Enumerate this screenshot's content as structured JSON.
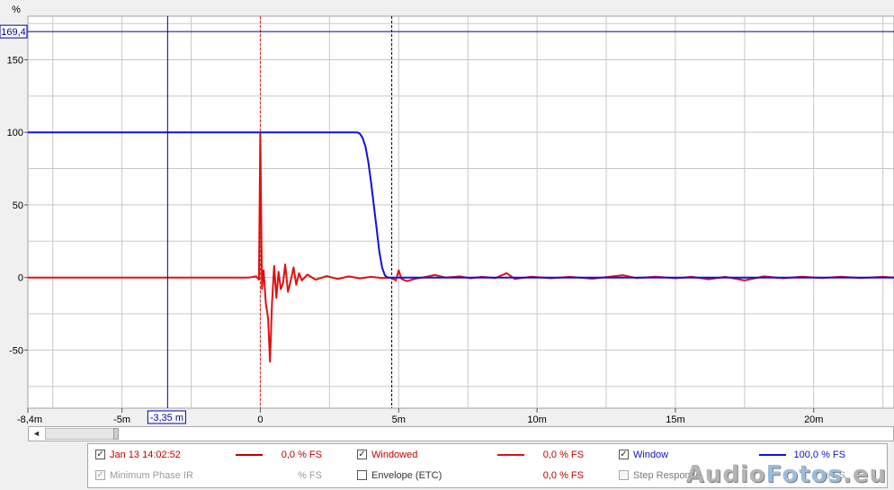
{
  "chart_data": {
    "type": "line",
    "ylabel": "%",
    "xlim": [
      -8.4,
      22.9
    ],
    "ylim": [
      -90,
      180
    ],
    "x_ticks": [
      {
        "v": -8.4,
        "label": "-8,4m"
      },
      {
        "v": -5,
        "label": "-5m"
      },
      {
        "v": 0,
        "label": "0"
      },
      {
        "v": 5,
        "label": "5m"
      },
      {
        "v": 10,
        "label": "10m"
      },
      {
        "v": 15,
        "label": "15m"
      },
      {
        "v": 20,
        "label": "20m"
      }
    ],
    "y_ticks": [
      {
        "v": 150,
        "label": "150"
      },
      {
        "v": 100,
        "label": "100"
      },
      {
        "v": 50,
        "label": "50"
      },
      {
        "v": 0,
        "label": "0"
      },
      {
        "v": -50,
        "label": "-50"
      }
    ],
    "cursor": {
      "x": -3.35,
      "x_label": "-3,35 m",
      "y": 169.4,
      "y_label": "169,4"
    },
    "markers": [
      {
        "x": 0,
        "color": "#e02020",
        "style": "dashed"
      },
      {
        "x": 4.75,
        "color": "#000000",
        "style": "dashed"
      }
    ],
    "grid": true,
    "series": [
      {
        "name": "Window",
        "color": "#1010e0",
        "points": [
          [
            -8.4,
            100
          ],
          [
            3.5,
            100
          ],
          [
            3.6,
            99
          ],
          [
            3.7,
            96
          ],
          [
            3.8,
            90
          ],
          [
            3.9,
            80
          ],
          [
            4.0,
            66
          ],
          [
            4.1,
            50
          ],
          [
            4.2,
            34
          ],
          [
            4.3,
            18
          ],
          [
            4.4,
            7
          ],
          [
            4.5,
            1.5
          ],
          [
            4.6,
            0
          ],
          [
            22.9,
            0
          ]
        ]
      },
      {
        "name": "Windowed",
        "color": "#e01010",
        "points": [
          [
            -8.4,
            0
          ],
          [
            -0.4,
            0
          ],
          [
            -0.15,
            0.8
          ],
          [
            -0.05,
            -1.5
          ],
          [
            0.0,
            100
          ],
          [
            0.06,
            -8
          ],
          [
            0.12,
            5
          ],
          [
            0.2,
            -18
          ],
          [
            0.28,
            -28
          ],
          [
            0.35,
            -58
          ],
          [
            0.42,
            -18
          ],
          [
            0.5,
            8
          ],
          [
            0.58,
            -14
          ],
          [
            0.66,
            4
          ],
          [
            0.74,
            -8
          ],
          [
            0.82,
            -4
          ],
          [
            0.9,
            9
          ],
          [
            1.0,
            -10
          ],
          [
            1.1,
            -2
          ],
          [
            1.2,
            7
          ],
          [
            1.3,
            -5
          ],
          [
            1.4,
            3
          ],
          [
            1.5,
            -2
          ],
          [
            1.7,
            2
          ],
          [
            2.0,
            -1.5
          ],
          [
            2.4,
            1
          ],
          [
            2.8,
            -1
          ],
          [
            3.2,
            0.8
          ],
          [
            3.6,
            -0.6
          ],
          [
            4.0,
            0.5
          ],
          [
            4.4,
            -0.4
          ],
          [
            4.7,
            0
          ],
          [
            4.9,
            -2
          ],
          [
            5.0,
            5
          ],
          [
            5.1,
            -1
          ],
          [
            5.3,
            -2.5
          ],
          [
            5.6,
            -0.8
          ],
          [
            6.0,
            0.5
          ],
          [
            6.3,
            1.8
          ],
          [
            6.7,
            0
          ],
          [
            7.2,
            0.8
          ],
          [
            7.6,
            -0.5
          ],
          [
            8.0,
            0.5
          ],
          [
            8.5,
            -0.3
          ],
          [
            8.9,
            3
          ],
          [
            9.2,
            -1
          ],
          [
            9.8,
            0.6
          ],
          [
            10.5,
            -0.5
          ],
          [
            11.2,
            0.5
          ],
          [
            12.0,
            -0.8
          ],
          [
            12.6,
            0.5
          ],
          [
            13.1,
            1.6
          ],
          [
            13.6,
            -0.4
          ],
          [
            14.3,
            0.6
          ],
          [
            15.0,
            -0.5
          ],
          [
            15.6,
            0.5
          ],
          [
            16.2,
            -1.2
          ],
          [
            16.8,
            0.5
          ],
          [
            17.5,
            -2
          ],
          [
            18.2,
            0.8
          ],
          [
            18.9,
            -0.5
          ],
          [
            19.6,
            0.6
          ],
          [
            20.3,
            -0.3
          ],
          [
            21.0,
            0.6
          ],
          [
            21.7,
            -0.4
          ],
          [
            22.5,
            0.5
          ],
          [
            22.9,
            0
          ]
        ]
      }
    ]
  },
  "legend": {
    "row1": {
      "trace_name": "Jan 13 14:02:52",
      "trace_value": "0,0 % FS",
      "windowed_name": "Windowed",
      "windowed_value": "0,0 % FS",
      "window_name": "Window",
      "window_value": "100,0 % FS"
    },
    "row2": {
      "minphase_name": "Minimum Phase IR",
      "minphase_value": "% FS",
      "envelope_name": "Envelope (ETC)",
      "envelope_value": "0,0 % FS",
      "step_name": "Step Response",
      "step_value": "% FS"
    },
    "check_mark": "✓"
  },
  "scrollbar": {
    "left_arrow": "◄"
  },
  "watermark": {
    "part1": "Audio",
    "part2": "Fotos",
    "part3": ".eu"
  },
  "colors": {
    "red": "#e01010",
    "blue": "#1010e0",
    "grid": "#c8c8c8"
  }
}
